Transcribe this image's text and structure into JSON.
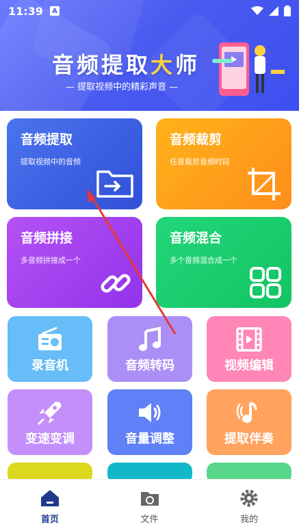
{
  "status": {
    "time": "11:39",
    "badge": "A"
  },
  "banner": {
    "title_a": "音频提",
    "title_b": "取",
    "title_c": "大",
    "title_d": "师",
    "subtitle": "— 提取视频中的精彩声音 —"
  },
  "cards": {
    "extract": {
      "title": "音频提取",
      "desc": "提取视频中的音频"
    },
    "cut": {
      "title": "音频裁剪",
      "desc": "任意裁剪音频时段"
    },
    "join": {
      "title": "音频拼接",
      "desc": "多音频拼接成一个"
    },
    "mix": {
      "title": "音频混合",
      "desc": "多个音频混合成一个"
    }
  },
  "tools": [
    {
      "label": "录音机",
      "icon": "radio-icon"
    },
    {
      "label": "音频转码",
      "icon": "music-note-icon"
    },
    {
      "label": "视频编辑",
      "icon": "film-icon"
    },
    {
      "label": "变速变调",
      "icon": "rocket-icon"
    },
    {
      "label": "音量调整",
      "icon": "speaker-icon"
    },
    {
      "label": "提取伴奏",
      "icon": "music-broadcast-icon"
    }
  ],
  "nav": [
    {
      "label": "首页",
      "icon": "home-icon"
    },
    {
      "label": "文件",
      "icon": "folder-icon"
    },
    {
      "label": "我的",
      "icon": "gear-icon"
    }
  ],
  "colors": {
    "banner": "#4a5bf0",
    "extract": "#3c63e6",
    "cut": "#ffa11a",
    "join": "#a93ff0",
    "mix": "#1dcf6e",
    "radio": "#62b8f5",
    "transcode": "#a98cf5",
    "video": "#ff82b4",
    "speed": "#c38cfa",
    "volume": "#5c7df5",
    "accompany": "#ff9f5a",
    "nav_active": "#1f3a8a"
  }
}
